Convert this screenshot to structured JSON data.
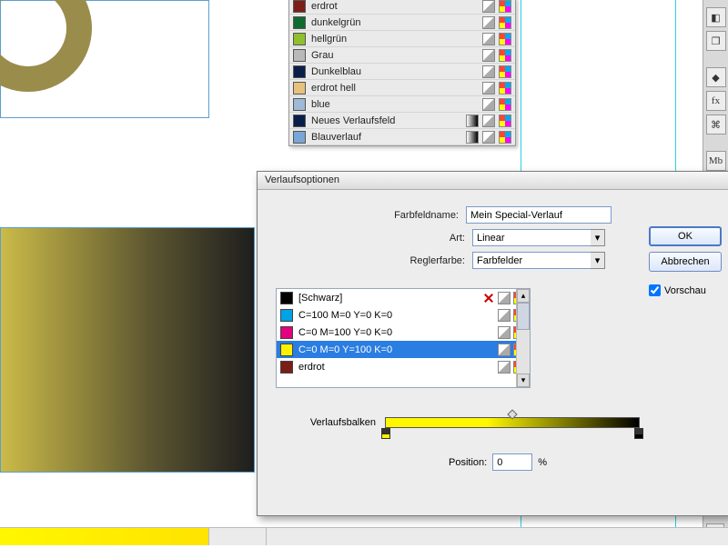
{
  "swatches": [
    {
      "name": "erdrot",
      "color": "#7a1e16"
    },
    {
      "name": "dunkelgrün",
      "color": "#0e6a2e"
    },
    {
      "name": "hellgrün",
      "color": "#8fbf2f"
    },
    {
      "name": "Grau",
      "color": "#b9b9b9"
    },
    {
      "name": "Dunkelblau",
      "color": "#0b1e4a"
    },
    {
      "name": "erdrot hell",
      "color": "#e7c27d"
    },
    {
      "name": "blue",
      "color": "#9fb9d6"
    },
    {
      "name": "Neues Verlaufsfeld",
      "color": "#0b1e4a"
    },
    {
      "name": "Blauverlauf",
      "color": "#7aa6d6"
    }
  ],
  "dialog": {
    "title": "Verlaufsoptionen",
    "fieldname_label": "Farbfeldname:",
    "fieldname_value": "Mein Special-Verlauf",
    "type_label": "Art:",
    "type_value": "Linear",
    "stopcolor_label": "Reglerfarbe:",
    "stopcolor_value": "Farbfelder",
    "ok": "OK",
    "cancel": "Abbrechen",
    "preview": "Vorschau",
    "gradbar_label": "Verlaufsbalken",
    "position_label": "Position:",
    "position_value": "0",
    "position_unit": "%"
  },
  "colorlist": [
    {
      "name": "[Schwarz]",
      "color": "#000000",
      "hasRedX": true
    },
    {
      "name": "C=100 M=0 Y=0 K=0",
      "color": "#00a2e8"
    },
    {
      "name": "C=0 M=100 Y=0 K=0",
      "color": "#e4007f"
    },
    {
      "name": "C=0 M=0 Y=100 K=0",
      "color": "#fff200",
      "selected": true
    },
    {
      "name": "erdrot",
      "color": "#7a1e16"
    }
  ],
  "dock_labels": [
    "◧",
    "❐",
    "◆",
    "fx",
    "⌘",
    "Mb"
  ]
}
